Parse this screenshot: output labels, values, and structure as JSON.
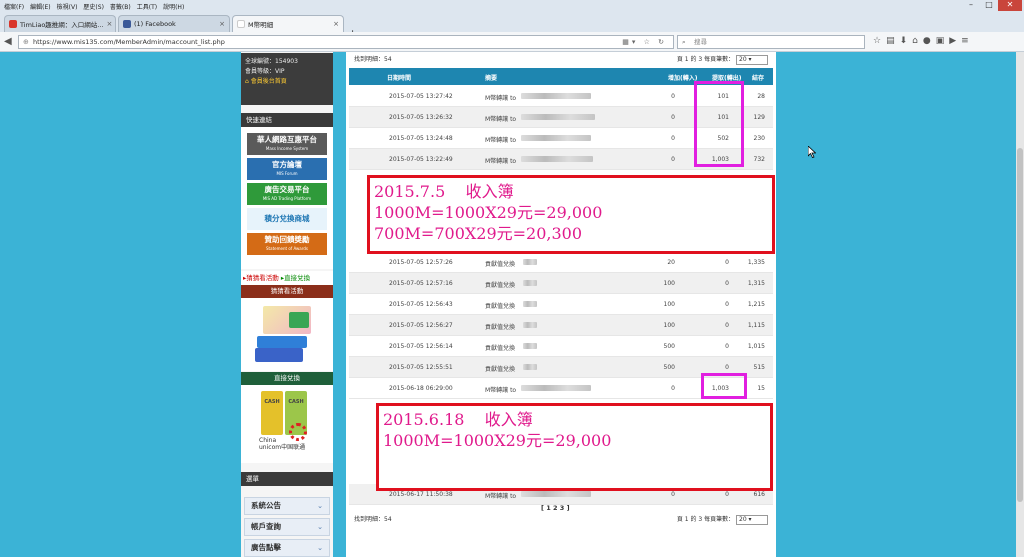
{
  "browser": {
    "menu": [
      "檔案(F)",
      "編輯(E)",
      "檢視(V)",
      "歷史(S)",
      "書籤(B)",
      "工具(T)",
      "說明(H)"
    ],
    "tabs": [
      {
        "label": "TimLiao趣推網：入口網站...",
        "color": "#d9352b"
      },
      {
        "label": "(1) Facebook",
        "color": "#3b5998"
      },
      {
        "label": "M幣明細",
        "color": "#ffffff"
      }
    ],
    "new_tab": "+",
    "url": "https://www.mis135.com/MemberAdmin/maccount_list.php",
    "search_placeholder": "搜尋"
  },
  "sidebar": {
    "member_id": "全球編號：154903",
    "member_level": "會員等級：VIP",
    "home_link": "會員後台首頁",
    "quick_links_title": "快速連結",
    "quick_links": [
      {
        "title": "華人網路互惠平台",
        "sub": "Mass Income System",
        "color": "#5a5a5a"
      },
      {
        "title": "官方論壇",
        "sub": "MIS Forum",
        "color": "#2a6fb0"
      },
      {
        "title": "廣告交易平台",
        "sub": "MIS AD Trading Platform",
        "color": "#2f9a3a"
      },
      {
        "title": "積分兌換商城",
        "sub": "",
        "color": "#e7f3fb"
      },
      {
        "title": "贊助回饋獎勵",
        "sub": "Statement of Awards",
        "color": "#d46b16"
      }
    ],
    "promo_links": [
      "猜猜看活動",
      "直接兌換"
    ],
    "guess_title": "猜猜看活動",
    "direct_title": "直接兌換",
    "cash_label": "CASH",
    "unicom_lines": [
      "China",
      "unicom中国联通"
    ],
    "menu_title": "選單",
    "menu_items": [
      "系統公告",
      "帳戶查詢",
      "廣告點擊"
    ]
  },
  "table": {
    "found_label": "找到明細：54",
    "page_info": "頁 1 的 3  每頁筆數：",
    "per_page": "20",
    "headers": [
      "日期時間",
      "摘要",
      "增加(轉入)",
      "提取(轉出)",
      "結存"
    ],
    "rows": [
      {
        "date": "2015-07-05 13:27:42",
        "desc": "M幣轉讓 to",
        "in": "0",
        "out": "101",
        "bal": "28"
      },
      {
        "date": "2015-07-05 13:26:32",
        "desc": "M幣轉讓 to",
        "in": "0",
        "out": "101",
        "bal": "129"
      },
      {
        "date": "2015-07-05 13:24:48",
        "desc": "M幣轉讓 to",
        "in": "0",
        "out": "502",
        "bal": "230"
      },
      {
        "date": "2015-07-05 13:22:49",
        "desc": "M幣轉讓 to",
        "in": "0",
        "out": "1,003",
        "bal": "732"
      },
      {
        "date": "2015-07-05 12:57:26",
        "desc": "貢獻值兌換",
        "in": "20",
        "out": "0",
        "bal": "1,335"
      },
      {
        "date": "2015-07-05 12:57:16",
        "desc": "貢獻值兌換",
        "in": "100",
        "out": "0",
        "bal": "1,315"
      },
      {
        "date": "2015-07-05 12:56:43",
        "desc": "貢獻值兌換",
        "in": "100",
        "out": "0",
        "bal": "1,215"
      },
      {
        "date": "2015-07-05 12:56:27",
        "desc": "貢獻值兌換",
        "in": "100",
        "out": "0",
        "bal": "1,115"
      },
      {
        "date": "2015-07-05 12:56:14",
        "desc": "貢獻值兌換",
        "in": "500",
        "out": "0",
        "bal": "1,015"
      },
      {
        "date": "2015-07-05 12:55:51",
        "desc": "貢獻值兌換",
        "in": "500",
        "out": "0",
        "bal": "515"
      },
      {
        "date": "2015-06-18 06:29:00",
        "desc": "M幣轉讓 to",
        "in": "0",
        "out": "1,003",
        "bal": "15"
      }
    ],
    "partial_row": {
      "date": "2015-06-17 11:50:38",
      "desc": "M幣轉讓 to",
      "in": "0",
      "out": "0",
      "bal": "616"
    },
    "pagination": "[ 1 2 3 ]"
  },
  "annotations": {
    "note1": [
      "2015.7.5    收入簿",
      "1000M=1000X29元=29,000",
      "700M=700X29元=20,300"
    ],
    "note2": [
      "2015.6.18    收入簿",
      "1000M=1000X29元=29,000"
    ]
  }
}
